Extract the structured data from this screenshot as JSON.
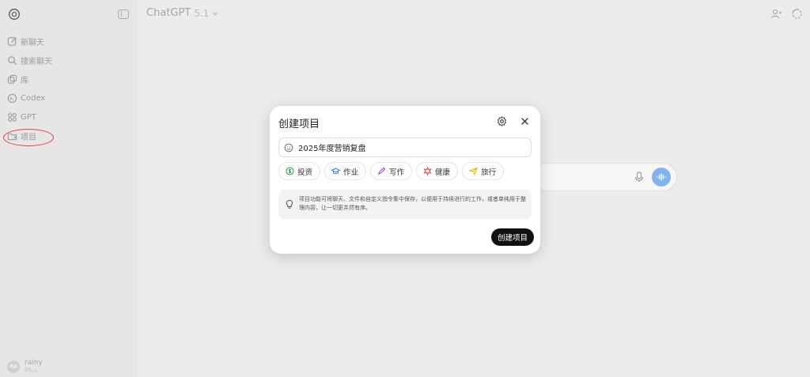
{
  "sidebar": {
    "items": [
      {
        "label": "新聊天",
        "icon": "edit-icon"
      },
      {
        "label": "搜索聊天",
        "icon": "search-icon"
      },
      {
        "label": "库",
        "icon": "library-icon"
      },
      {
        "label": "Codex",
        "icon": "codex-icon"
      },
      {
        "label": "GPT",
        "icon": "grid-icon"
      },
      {
        "label": "项目",
        "icon": "folder-icon"
      }
    ],
    "user": {
      "name": "rainy",
      "plan": "Plus",
      "initials": "RA"
    }
  },
  "header": {
    "model": "ChatGPT",
    "version": "5.1"
  },
  "modal": {
    "title": "创建项目",
    "name_value": "2025年度营销复盘",
    "chips": [
      {
        "label": "投资",
        "icon": "dollar-icon",
        "color": "#2e9d4f"
      },
      {
        "label": "作业",
        "icon": "graduation-cap-icon",
        "color": "#2b7fd6"
      },
      {
        "label": "写作",
        "icon": "pen-icon",
        "color": "#8e44c9"
      },
      {
        "label": "健康",
        "icon": "health-icon",
        "color": "#e03b3b"
      },
      {
        "label": "旅行",
        "icon": "plane-icon",
        "color": "#e0b800"
      }
    ],
    "info": "项目功能可将聊天、文件和自定义指令集中保存，以便用于持续进行的工作，或者单纯用于整理内容，让一切更井然有序。",
    "create_label": "创建项目"
  },
  "colors": {
    "accent_blue": "#7fb5ea",
    "annotation_red": "#e53935"
  }
}
